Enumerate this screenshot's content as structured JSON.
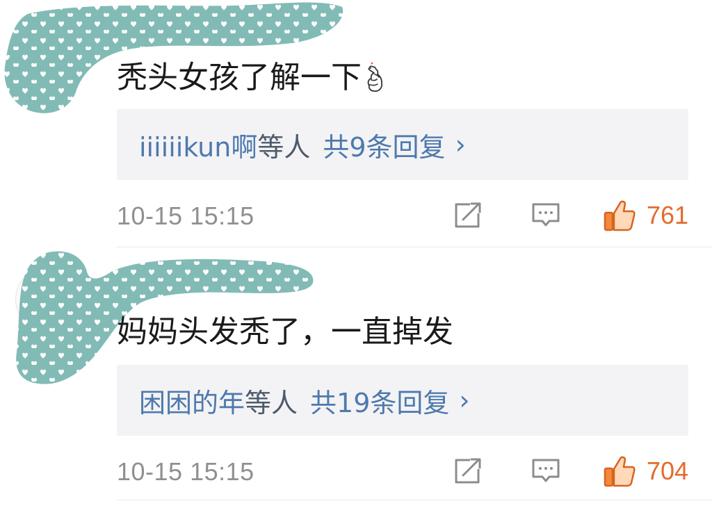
{
  "comments": [
    {
      "text": "秃头女孩了解一下",
      "emoji": "finger-heart-emoji",
      "reply_users": "iiiiiikun啊",
      "reply_suffix": "等人",
      "reply_count": "共9条回复",
      "reply_chevron": "›",
      "time": "10-15 15:15",
      "likes": "761"
    },
    {
      "text": "妈妈头发秃了，一直掉发",
      "reply_users": "困困的年",
      "reply_suffix": "等人",
      "reply_count": "共19条回复",
      "reply_chevron": "›",
      "time": "10-15 15:15",
      "likes": "704"
    }
  ],
  "icons": {
    "share": "share-icon",
    "comment": "comment-icon",
    "like": "thumbs-up-icon"
  },
  "colors": {
    "reply_link": "#4e79ad",
    "like": "#e36b2c",
    "redaction": "#82bbb6"
  }
}
